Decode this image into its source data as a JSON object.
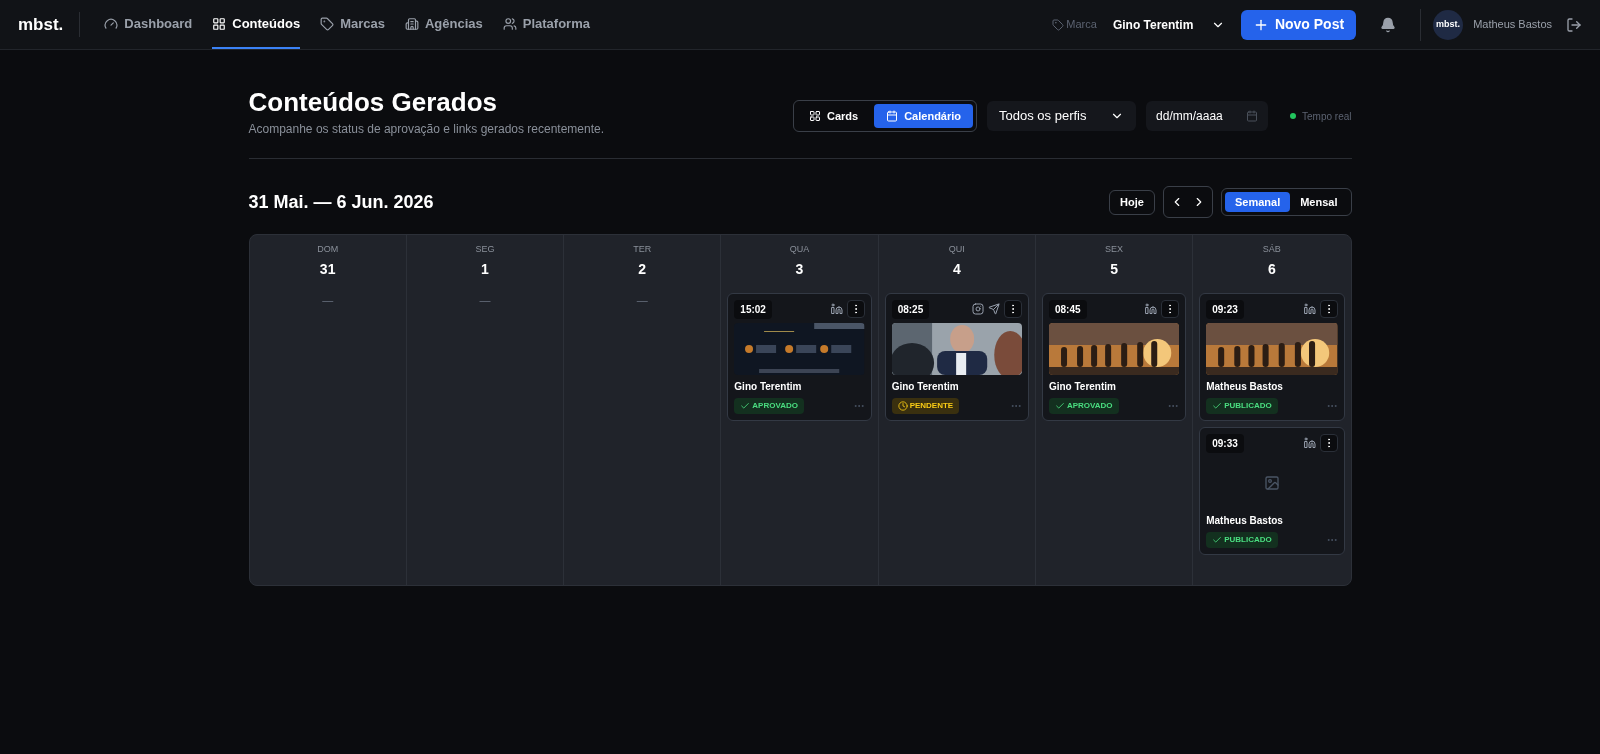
{
  "nav": {
    "logo": "mbst.",
    "items": [
      {
        "label": "Dashboard",
        "selected": false
      },
      {
        "label": "Conteúdos",
        "selected": true
      },
      {
        "label": "Marcas",
        "selected": false
      },
      {
        "label": "Agências",
        "selected": false
      },
      {
        "label": "Plataforma",
        "selected": false
      }
    ],
    "brand_label": "Marca",
    "brand_value": "Gino Terentim",
    "new_post": "Novo Post",
    "avatar": "mbst.",
    "user": "Matheus Bastos"
  },
  "header": {
    "title": "Conteúdos Gerados",
    "subtitle": "Acompanhe os status de aprovação e links gerados recentemente.",
    "views": [
      {
        "label": "Cards",
        "selected": false
      },
      {
        "label": "Calendário",
        "selected": true
      }
    ],
    "profile_filter": "Todos os perfis",
    "date_placeholder": "dd/mm/aaaa",
    "live": "Tempo real"
  },
  "calendar": {
    "range": "31 Mai. — 6 Jun. 2026",
    "today": "Hoje",
    "modes": [
      {
        "label": "Semanal",
        "selected": true
      },
      {
        "label": "Mensal",
        "selected": false
      }
    ],
    "days": [
      {
        "weekday": "DOM",
        "date": "31",
        "empty_mark": "—"
      },
      {
        "weekday": "SEG",
        "date": "1",
        "empty_mark": "—"
      },
      {
        "weekday": "TER",
        "date": "2",
        "empty_mark": "—"
      },
      {
        "weekday": "QUA",
        "date": "3",
        "posts": [
          {
            "time": "15:02",
            "author": "Gino Terentim",
            "status": {
              "label": "APROVADO",
              "kind": "approved"
            }
          }
        ]
      },
      {
        "weekday": "QUI",
        "date": "4",
        "posts": [
          {
            "time": "08:25",
            "author": "Gino Terentim",
            "status": {
              "label": "PENDENTE",
              "kind": "pending"
            }
          }
        ]
      },
      {
        "weekday": "SEX",
        "date": "5",
        "posts": [
          {
            "time": "08:45",
            "author": "Gino Terentim",
            "status": {
              "label": "APROVADO",
              "kind": "approved"
            }
          }
        ]
      },
      {
        "weekday": "SÁB",
        "date": "6",
        "posts": [
          {
            "time": "09:23",
            "author": "Matheus Bastos",
            "status": {
              "label": "PUBLICADO",
              "kind": "published"
            }
          },
          {
            "time": "09:33",
            "author": "Matheus Bastos",
            "status": {
              "label": "PUBLICADO",
              "kind": "published"
            }
          }
        ]
      }
    ]
  }
}
